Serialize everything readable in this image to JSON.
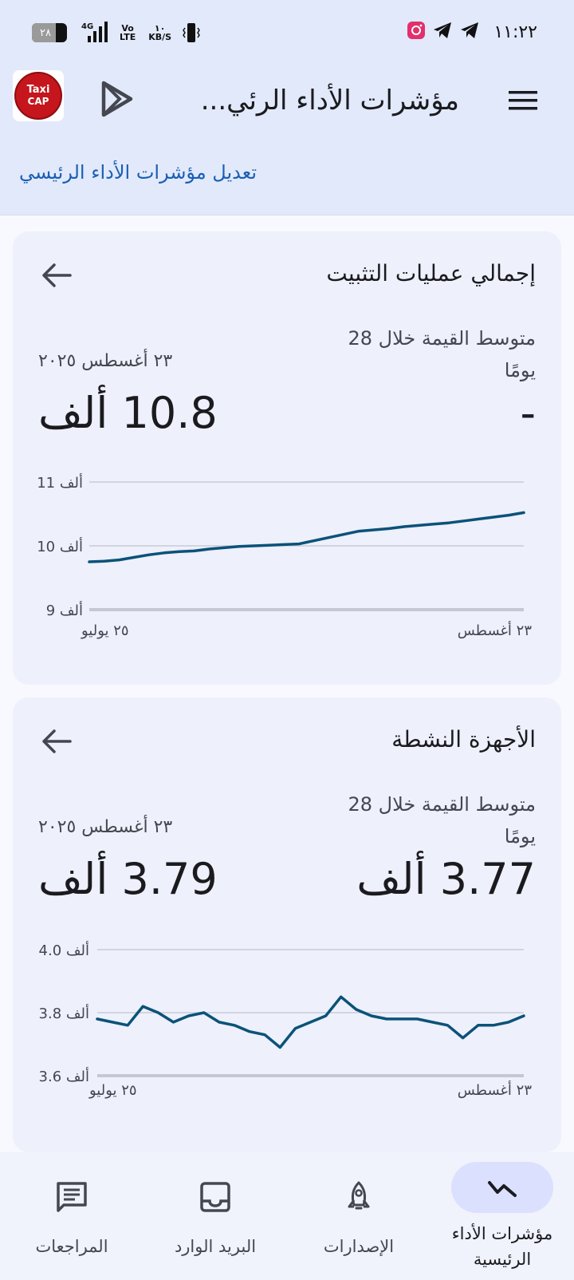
{
  "status_bar": {
    "battery": "٢٨",
    "network": "4G",
    "volte_top": "Vo",
    "volte_bottom": "LTE",
    "speed_top": "١٠",
    "speed_bottom": "KB/S",
    "time": "١١:٢٢"
  },
  "app_bar": {
    "title": "مؤشرات الأداء الرئي...",
    "logo_top": "Taxi",
    "logo_bottom": "CAP",
    "edit_link": "تعديل مؤشرات الأداء الرئيسي"
  },
  "cards": [
    {
      "title": "إجمالي عمليات التثبيت",
      "avg_label": "متوسط القيمة خلال 28 يومًا",
      "avg_value": "-",
      "date": "٢٣ أغسطس ٢٠٢٥",
      "value": "10.8 ألف"
    },
    {
      "title": "الأجهزة النشطة",
      "avg_label": "متوسط القيمة خلال 28 يومًا",
      "avg_value": "3.77 ألف",
      "date": "٢٣ أغسطس ٢٠٢٥",
      "value": "3.79 ألف"
    }
  ],
  "chart_data": [
    {
      "type": "line",
      "x_labels": [
        "٢٥ يوليو",
        "٢٣ أغسطس"
      ],
      "y_ticks": [
        9,
        10,
        11
      ],
      "y_tick_labels": [
        "9 ألف",
        "10 ألف",
        "11 ألف"
      ],
      "ylim": [
        9,
        11
      ],
      "grid": true,
      "color": "#0b5278",
      "series": [
        {
          "values": [
            9.75,
            9.76,
            9.78,
            9.82,
            9.86,
            9.89,
            9.91,
            9.92,
            9.95,
            9.97,
            9.99,
            10.0,
            10.01,
            10.02,
            10.03,
            10.08,
            10.13,
            10.18,
            10.23,
            10.25,
            10.27,
            10.3,
            10.32,
            10.34,
            10.36,
            10.39,
            10.42,
            10.45,
            10.48,
            10.52
          ]
        }
      ]
    },
    {
      "type": "line",
      "x_labels": [
        "٢٥ يوليو",
        "٢٣ أغسطس"
      ],
      "y_ticks": [
        3.6,
        3.8,
        4.0
      ],
      "y_tick_labels": [
        "3.6 ألف",
        "3.8 ألف",
        "4.0 ألف"
      ],
      "ylim": [
        3.6,
        4.0
      ],
      "grid": true,
      "color": "#0b5278",
      "series": [
        {
          "values": [
            3.78,
            3.77,
            3.76,
            3.82,
            3.8,
            3.77,
            3.79,
            3.8,
            3.77,
            3.76,
            3.74,
            3.73,
            3.69,
            3.75,
            3.77,
            3.79,
            3.85,
            3.81,
            3.79,
            3.78,
            3.78,
            3.78,
            3.77,
            3.76,
            3.72,
            3.76,
            3.76,
            3.77,
            3.79
          ]
        }
      ]
    }
  ],
  "bottom_nav": [
    {
      "label": "مؤشرات الأداء الرئيسية",
      "icon": "kpi-trend-icon",
      "active": true
    },
    {
      "label": "الإصدارات",
      "icon": "rocket-icon",
      "active": false
    },
    {
      "label": "البريد الوارد",
      "icon": "inbox-icon",
      "active": false
    },
    {
      "label": "المراجعات",
      "icon": "reviews-icon",
      "active": false
    }
  ]
}
